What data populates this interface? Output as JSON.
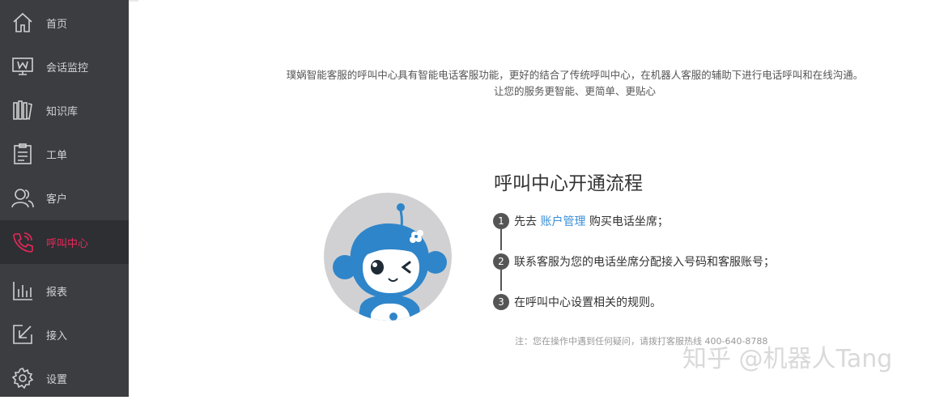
{
  "sidebar": {
    "items": [
      {
        "label": "首页",
        "icon": "home-icon"
      },
      {
        "label": "会话监控",
        "icon": "monitor-icon"
      },
      {
        "label": "知识库",
        "icon": "books-icon"
      },
      {
        "label": "工单",
        "icon": "clipboard-icon"
      },
      {
        "label": "客户",
        "icon": "users-icon"
      },
      {
        "label": "呼叫中心",
        "icon": "phone-icon",
        "active": true
      },
      {
        "label": "报表",
        "icon": "bar-chart-icon"
      },
      {
        "label": "接入",
        "icon": "arrow-in-icon"
      },
      {
        "label": "设置",
        "icon": "gear-icon"
      }
    ],
    "active_color": "#e8285a"
  },
  "intro": {
    "line1": "璞娲智能客服的呼叫中心具有智能电话客服功能，更好的结合了传统呼叫中心，在机器人客服的辅助下进行电话呼叫和在线沟通。",
    "line2": "让您的服务更智能、更简单、更贴心"
  },
  "title": "呼叫中心开通流程",
  "steps": [
    {
      "num": "1",
      "prefix": "先去 ",
      "link": "账户管理",
      "suffix": " 购买电话坐席；"
    },
    {
      "num": "2",
      "text": "联系客服为您的电话坐席分配接入号码和客服账号；"
    },
    {
      "num": "3",
      "text": "在呼叫中心设置相关的规则。"
    }
  ],
  "note": "注：您在操作中遇到任何疑问，请拨打客服热线 400-640-8788",
  "watermark": "知乎 @机器人Tang",
  "colors": {
    "link": "#3a8fd8",
    "sidebar_bg": "#3c3d41",
    "mascot_blue": "#2f85c9"
  }
}
